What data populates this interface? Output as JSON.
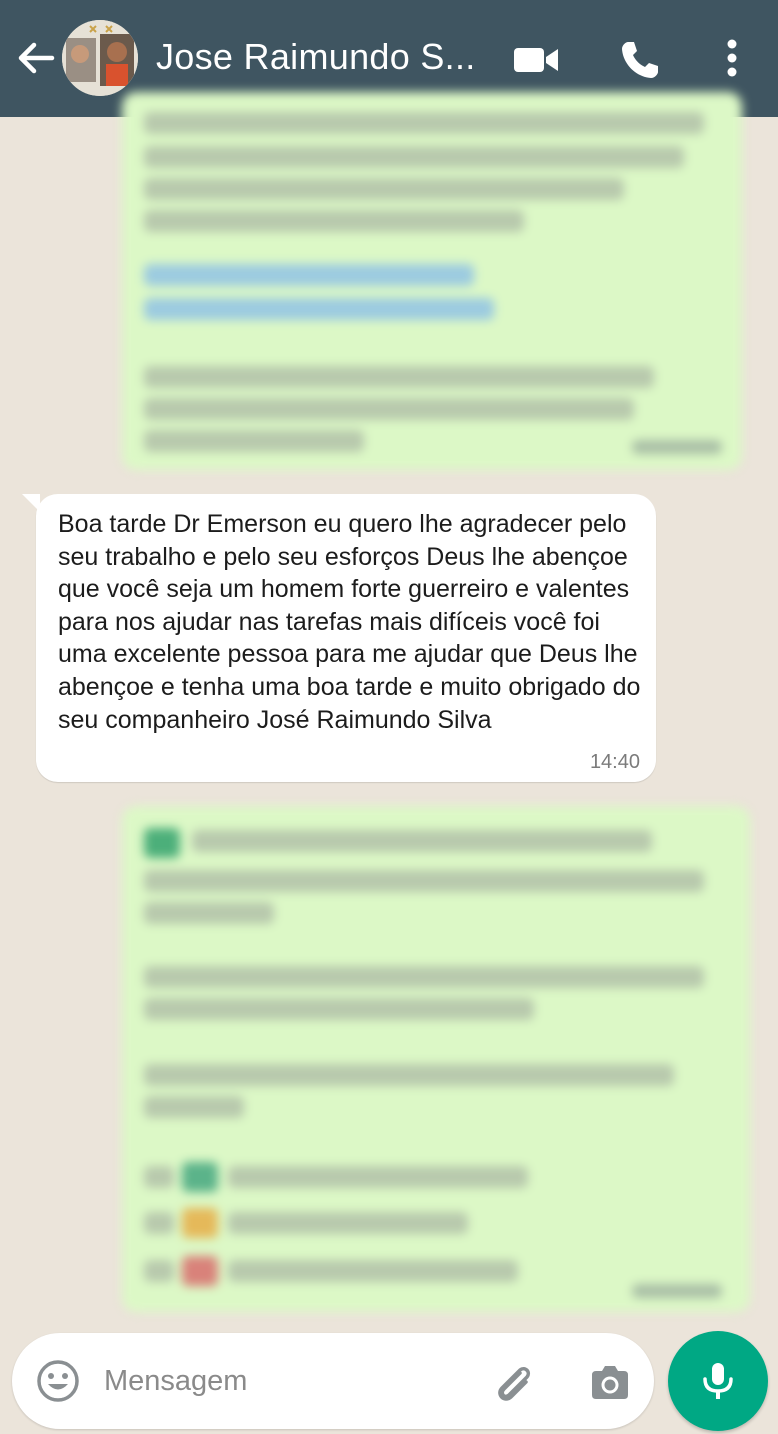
{
  "header": {
    "contact_name": "Jose Raimundo S...",
    "icons": [
      "back-arrow-icon",
      "avatar",
      "video-call-icon",
      "voice-call-icon",
      "more-options-icon"
    ]
  },
  "messages": [
    {
      "direction": "incoming",
      "text": "Boa tarde Dr Emerson eu quero lhe agradecer pelo seu trabalho e pelo seu esforços Deus lhe abençoe que você seja um homem forte guerreiro e valentes para nos ajudar nas tarefas mais difíceis você foi uma excelente pessoa para me ajudar que Deus lhe abençoe e tenha uma boa tarde e muito obrigado do seu companheiro José Raimundo Silva",
      "time": "14:40"
    }
  ],
  "composer": {
    "placeholder": "Mensagem"
  },
  "colors": {
    "header_bg": "#3f5561",
    "outgoing_bubble": "#dcf8c6",
    "incoming_bubble": "#ffffff",
    "mic_button": "#00a884"
  }
}
